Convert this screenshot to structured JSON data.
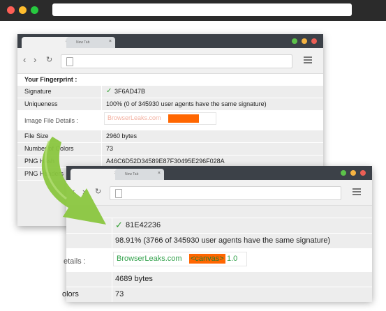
{
  "outer": {
    "dots": [
      "#ff5f56",
      "#ffbd2e",
      "#27c93f"
    ]
  },
  "window1": {
    "tab_active_label": "",
    "tab_inactive_label": "New Tab",
    "tab_close": "×",
    "nav_back": "‹",
    "nav_forward": "›",
    "nav_reload": "↻",
    "heading": "Your Fingerprint :",
    "rows": [
      {
        "label": "Signature",
        "check": "✓",
        "value": "3F6AD47B"
      },
      {
        "label": "Uniqueness",
        "value": "100% (0 of 345930 user agents have the same signature)"
      },
      {
        "label": "Image File Details :",
        "canvas_text": "BrowserLeaks.com"
      },
      {
        "label": "File Size",
        "value": "2960 bytes"
      },
      {
        "label": "Number of Colors",
        "value": "73"
      },
      {
        "label": "PNG Hash",
        "value": "A46C6D52D34589E87F30495E296F028A"
      },
      {
        "label": "PNG Headers",
        "value": ""
      }
    ]
  },
  "window2": {
    "tab_active_label": "",
    "tab_inactive_label": "New Tab",
    "tab_close": "×",
    "nav_back": "‹",
    "nav_forward": "›",
    "nav_reload": "↻",
    "rows": [
      {
        "label": "",
        "check": "✓",
        "value": "81E42236"
      },
      {
        "label": "",
        "value": "98.91% (3766 of 345930 user agents have the same signature)"
      },
      {
        "label": "etails :",
        "canvas_text": "BrowserLeaks.com",
        "canvas_tag": "<canvas>",
        "canvas_version": "1.0"
      },
      {
        "label": "",
        "value": "4689 bytes"
      },
      {
        "label": "olors",
        "value": "73"
      }
    ]
  },
  "colors": {
    "check_green": "#2e9e2e",
    "canvas_orange": "#ff6600",
    "arrow_green": "#8ac63f"
  }
}
